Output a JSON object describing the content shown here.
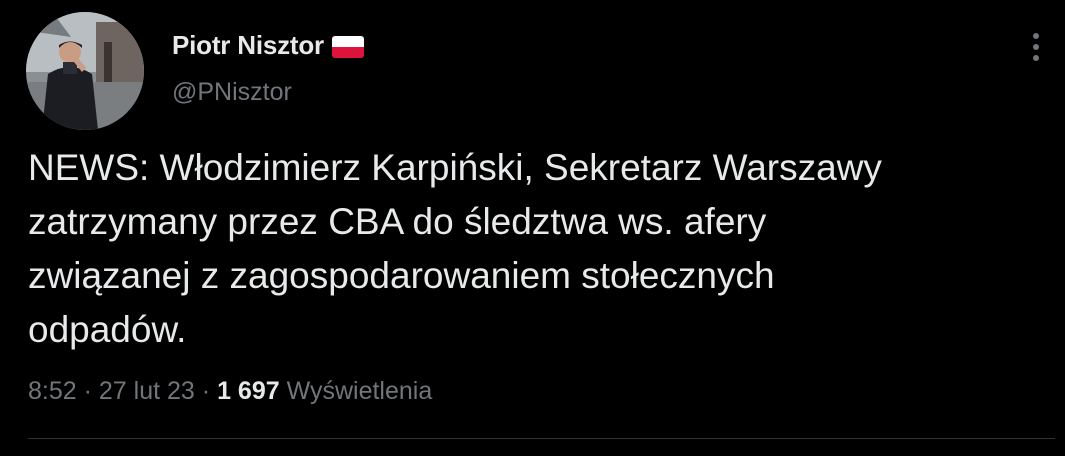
{
  "author": {
    "display_name": "Piotr Nisztor",
    "handle": "@PNisztor",
    "flag_icon": "poland-flag-icon"
  },
  "tweet": {
    "lines": [
      "NEWS: Włodzimierz Karpiński, Sekretarz Warszawy",
      "zatrzymany przez CBA do śledztwa ws. afery",
      "związanej z zagospodarowaniem stołecznych",
      "odpadów."
    ]
  },
  "meta": {
    "time": "8:52",
    "separator": "·",
    "date": "27 lut 23",
    "views_count": "1 697",
    "views_label": "Wyświetlenia"
  },
  "colors": {
    "background": "#000000",
    "text_primary": "#e7e9ea",
    "text_secondary": "#71767b",
    "divider": "#2f3336",
    "flag_red": "#dc143c"
  }
}
